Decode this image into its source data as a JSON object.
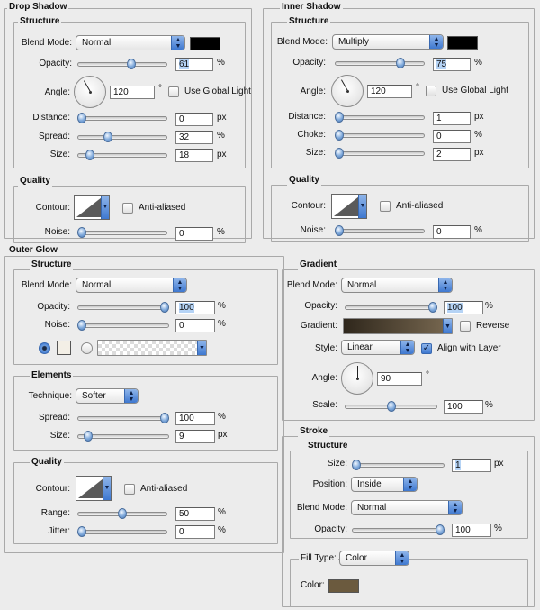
{
  "drop_shadow": {
    "title": "Drop Shadow",
    "structure": {
      "title": "Structure",
      "blend_mode_label": "Blend Mode:",
      "blend_mode": "Normal",
      "color": "#000000",
      "opacity_label": "Opacity:",
      "opacity": "61",
      "opacity_unit": "%",
      "opacity_frac": 0.61,
      "angle_label": "Angle:",
      "angle": "120",
      "angle_unit": "°",
      "use_global_light": "Use Global Light",
      "distance_label": "Distance:",
      "distance": "0",
      "distance_unit": "px",
      "distance_frac": 0.0,
      "spread_label": "Spread:",
      "spread": "32",
      "spread_unit": "%",
      "spread_frac": 0.32,
      "size_label": "Size:",
      "size": "18",
      "size_unit": "px",
      "size_frac": 0.1
    },
    "quality": {
      "title": "Quality",
      "contour_label": "Contour:",
      "anti_aliased": "Anti-aliased",
      "noise_label": "Noise:",
      "noise": "0",
      "noise_unit": "%",
      "noise_frac": 0.0
    }
  },
  "inner_shadow": {
    "title": "Inner Shadow",
    "structure": {
      "title": "Structure",
      "blend_mode_label": "Blend Mode:",
      "blend_mode": "Multiply",
      "color": "#000000",
      "opacity_label": "Opacity:",
      "opacity": "75",
      "opacity_unit": "%",
      "opacity_frac": 0.75,
      "angle_label": "Angle:",
      "angle": "120",
      "angle_unit": "°",
      "use_global_light": "Use Global Light",
      "distance_label": "Distance:",
      "distance": "1",
      "distance_unit": "px",
      "distance_frac": 0.0,
      "choke_label": "Choke:",
      "choke": "0",
      "choke_unit": "%",
      "choke_frac": 0.0,
      "size_label": "Size:",
      "size": "2",
      "size_unit": "px",
      "size_frac": 0.0
    },
    "quality": {
      "title": "Quality",
      "contour_label": "Contour:",
      "anti_aliased": "Anti-aliased",
      "noise_label": "Noise:",
      "noise": "0",
      "noise_unit": "%",
      "noise_frac": 0.0
    }
  },
  "outer_glow": {
    "title": "Outer Glow",
    "structure": {
      "title": "Structure",
      "blend_mode_label": "Blend Mode:",
      "blend_mode": "Normal",
      "opacity_label": "Opacity:",
      "opacity": "100",
      "opacity_unit": "%",
      "opacity_frac": 1.0,
      "noise_label": "Noise:",
      "noise": "0",
      "noise_unit": "%",
      "noise_frac": 0.0,
      "color": "#f3efe6"
    },
    "elements": {
      "title": "Elements",
      "technique_label": "Technique:",
      "technique": "Softer",
      "spread_label": "Spread:",
      "spread": "100",
      "spread_unit": "%",
      "spread_frac": 1.0,
      "size_label": "Size:",
      "size": "9",
      "size_unit": "px",
      "size_frac": 0.08
    },
    "quality": {
      "title": "Quality",
      "contour_label": "Contour:",
      "anti_aliased": "Anti-aliased",
      "range_label": "Range:",
      "range": "50",
      "range_unit": "%",
      "range_frac": 0.5,
      "jitter_label": "Jitter:",
      "jitter": "0",
      "jitter_unit": "%",
      "jitter_frac": 0.0
    }
  },
  "gradient": {
    "title": "Gradient",
    "blend_mode_label": "Blend Mode:",
    "blend_mode": "Normal",
    "opacity_label": "Opacity:",
    "opacity": "100",
    "opacity_unit": "%",
    "opacity_frac": 1.0,
    "gradient_label": "Gradient:",
    "gradient_from": "#2f271c",
    "gradient_to": "#7a6a52",
    "reverse": "Reverse",
    "style_label": "Style:",
    "style": "Linear",
    "align_with_layer": "Align with Layer",
    "angle_label": "Angle:",
    "angle": "90",
    "angle_unit": "°",
    "scale_label": "Scale:",
    "scale": "100",
    "scale_unit": "%",
    "scale_frac": 0.5
  },
  "stroke": {
    "title": "Stroke",
    "structure": {
      "title": "Structure",
      "size_label": "Size:",
      "size": "1",
      "size_unit": "px",
      "size_frac": 0.0,
      "position_label": "Position:",
      "position": "Inside",
      "blend_mode_label": "Blend Mode:",
      "blend_mode": "Normal",
      "opacity_label": "Opacity:",
      "opacity": "100",
      "opacity_unit": "%",
      "opacity_frac": 1.0
    },
    "fill_type_label": "Fill Type:",
    "fill_type": "Color",
    "color_label": "Color:",
    "color": "#6b5a3e"
  }
}
